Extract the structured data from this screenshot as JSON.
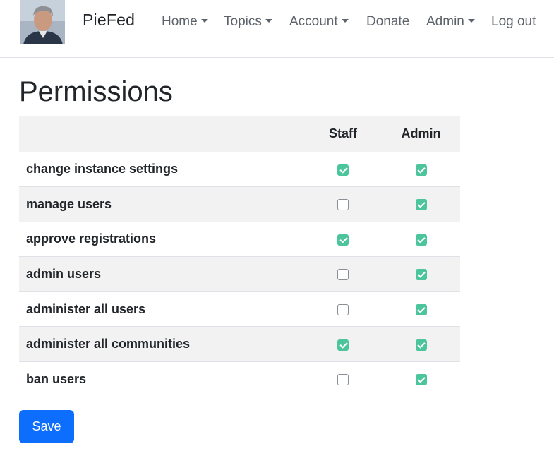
{
  "nav": {
    "brand": "PieFed",
    "items": [
      {
        "label": "Home",
        "dropdown": true
      },
      {
        "label": "Topics",
        "dropdown": true
      },
      {
        "label": "Account",
        "dropdown": true
      },
      {
        "label": "Donate",
        "dropdown": false
      },
      {
        "label": "Admin",
        "dropdown": true
      },
      {
        "label": "Log out",
        "dropdown": false
      }
    ]
  },
  "page": {
    "title": "Permissions"
  },
  "permissions_table": {
    "columns": [
      "",
      "Staff",
      "Admin"
    ],
    "rows": [
      {
        "label": "change instance settings",
        "staff": true,
        "admin": true
      },
      {
        "label": "manage users",
        "staff": false,
        "admin": true
      },
      {
        "label": "approve registrations",
        "staff": true,
        "admin": true
      },
      {
        "label": "admin users",
        "staff": false,
        "admin": true
      },
      {
        "label": "administer all users",
        "staff": false,
        "admin": true
      },
      {
        "label": "administer all communities",
        "staff": true,
        "admin": true
      },
      {
        "label": "ban users",
        "staff": false,
        "admin": true
      }
    ]
  },
  "actions": {
    "save_label": "Save"
  },
  "colors": {
    "checkbox_checked": "#4cc49c",
    "primary_button": "#0d6efd",
    "row_stripe": "#f2f2f2"
  }
}
